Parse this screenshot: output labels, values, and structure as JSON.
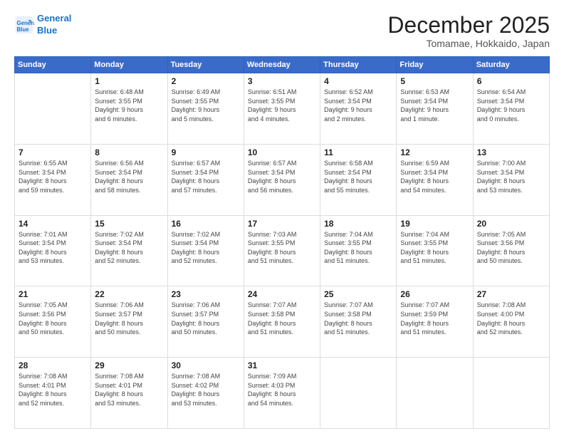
{
  "header": {
    "logo_line1": "General",
    "logo_line2": "Blue",
    "month": "December 2025",
    "location": "Tomamae, Hokkaido, Japan"
  },
  "weekdays": [
    "Sunday",
    "Monday",
    "Tuesday",
    "Wednesday",
    "Thursday",
    "Friday",
    "Saturday"
  ],
  "weeks": [
    [
      {
        "day": "",
        "info": ""
      },
      {
        "day": "1",
        "info": "Sunrise: 6:48 AM\nSunset: 3:55 PM\nDaylight: 9 hours\nand 6 minutes."
      },
      {
        "day": "2",
        "info": "Sunrise: 6:49 AM\nSunset: 3:55 PM\nDaylight: 9 hours\nand 5 minutes."
      },
      {
        "day": "3",
        "info": "Sunrise: 6:51 AM\nSunset: 3:55 PM\nDaylight: 9 hours\nand 4 minutes."
      },
      {
        "day": "4",
        "info": "Sunrise: 6:52 AM\nSunset: 3:54 PM\nDaylight: 9 hours\nand 2 minutes."
      },
      {
        "day": "5",
        "info": "Sunrise: 6:53 AM\nSunset: 3:54 PM\nDaylight: 9 hours\nand 1 minute."
      },
      {
        "day": "6",
        "info": "Sunrise: 6:54 AM\nSunset: 3:54 PM\nDaylight: 9 hours\nand 0 minutes."
      }
    ],
    [
      {
        "day": "7",
        "info": "Sunrise: 6:55 AM\nSunset: 3:54 PM\nDaylight: 8 hours\nand 59 minutes."
      },
      {
        "day": "8",
        "info": "Sunrise: 6:56 AM\nSunset: 3:54 PM\nDaylight: 8 hours\nand 58 minutes."
      },
      {
        "day": "9",
        "info": "Sunrise: 6:57 AM\nSunset: 3:54 PM\nDaylight: 8 hours\nand 57 minutes."
      },
      {
        "day": "10",
        "info": "Sunrise: 6:57 AM\nSunset: 3:54 PM\nDaylight: 8 hours\nand 56 minutes."
      },
      {
        "day": "11",
        "info": "Sunrise: 6:58 AM\nSunset: 3:54 PM\nDaylight: 8 hours\nand 55 minutes."
      },
      {
        "day": "12",
        "info": "Sunrise: 6:59 AM\nSunset: 3:54 PM\nDaylight: 8 hours\nand 54 minutes."
      },
      {
        "day": "13",
        "info": "Sunrise: 7:00 AM\nSunset: 3:54 PM\nDaylight: 8 hours\nand 53 minutes."
      }
    ],
    [
      {
        "day": "14",
        "info": "Sunrise: 7:01 AM\nSunset: 3:54 PM\nDaylight: 8 hours\nand 53 minutes."
      },
      {
        "day": "15",
        "info": "Sunrise: 7:02 AM\nSunset: 3:54 PM\nDaylight: 8 hours\nand 52 minutes."
      },
      {
        "day": "16",
        "info": "Sunrise: 7:02 AM\nSunset: 3:54 PM\nDaylight: 8 hours\nand 52 minutes."
      },
      {
        "day": "17",
        "info": "Sunrise: 7:03 AM\nSunset: 3:55 PM\nDaylight: 8 hours\nand 51 minutes."
      },
      {
        "day": "18",
        "info": "Sunrise: 7:04 AM\nSunset: 3:55 PM\nDaylight: 8 hours\nand 51 minutes."
      },
      {
        "day": "19",
        "info": "Sunrise: 7:04 AM\nSunset: 3:55 PM\nDaylight: 8 hours\nand 51 minutes."
      },
      {
        "day": "20",
        "info": "Sunrise: 7:05 AM\nSunset: 3:56 PM\nDaylight: 8 hours\nand 50 minutes."
      }
    ],
    [
      {
        "day": "21",
        "info": "Sunrise: 7:05 AM\nSunset: 3:56 PM\nDaylight: 8 hours\nand 50 minutes."
      },
      {
        "day": "22",
        "info": "Sunrise: 7:06 AM\nSunset: 3:57 PM\nDaylight: 8 hours\nand 50 minutes."
      },
      {
        "day": "23",
        "info": "Sunrise: 7:06 AM\nSunset: 3:57 PM\nDaylight: 8 hours\nand 50 minutes."
      },
      {
        "day": "24",
        "info": "Sunrise: 7:07 AM\nSunset: 3:58 PM\nDaylight: 8 hours\nand 51 minutes."
      },
      {
        "day": "25",
        "info": "Sunrise: 7:07 AM\nSunset: 3:58 PM\nDaylight: 8 hours\nand 51 minutes."
      },
      {
        "day": "26",
        "info": "Sunrise: 7:07 AM\nSunset: 3:59 PM\nDaylight: 8 hours\nand 51 minutes."
      },
      {
        "day": "27",
        "info": "Sunrise: 7:08 AM\nSunset: 4:00 PM\nDaylight: 8 hours\nand 52 minutes."
      }
    ],
    [
      {
        "day": "28",
        "info": "Sunrise: 7:08 AM\nSunset: 4:01 PM\nDaylight: 8 hours\nand 52 minutes."
      },
      {
        "day": "29",
        "info": "Sunrise: 7:08 AM\nSunset: 4:01 PM\nDaylight: 8 hours\nand 53 minutes."
      },
      {
        "day": "30",
        "info": "Sunrise: 7:08 AM\nSunset: 4:02 PM\nDaylight: 8 hours\nand 53 minutes."
      },
      {
        "day": "31",
        "info": "Sunrise: 7:09 AM\nSunset: 4:03 PM\nDaylight: 8 hours\nand 54 minutes."
      },
      {
        "day": "",
        "info": ""
      },
      {
        "day": "",
        "info": ""
      },
      {
        "day": "",
        "info": ""
      }
    ]
  ]
}
